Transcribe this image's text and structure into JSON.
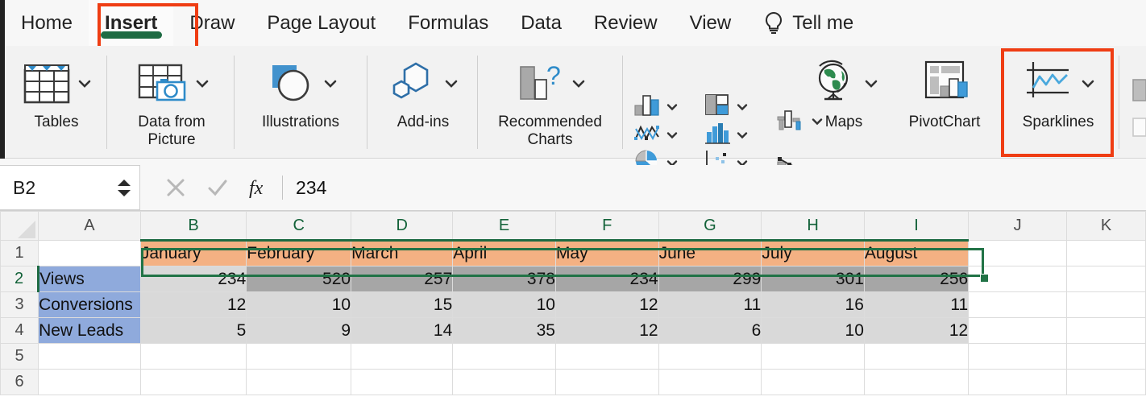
{
  "app": {
    "accent_green": "#217346",
    "annotation_color": "#ef3d13",
    "header_fill": "#f4b183",
    "label_fill": "#8faadc",
    "row_fill": "#d9d9d9",
    "selected_fill": "#a6a6a6"
  },
  "ribbon_tabs": [
    {
      "label": "Home",
      "active": false
    },
    {
      "label": "Insert",
      "active": true,
      "annotated": true
    },
    {
      "label": "Draw",
      "active": false
    },
    {
      "label": "Page Layout",
      "active": false
    },
    {
      "label": "Formulas",
      "active": false
    },
    {
      "label": "Data",
      "active": false
    },
    {
      "label": "Review",
      "active": false
    },
    {
      "label": "View",
      "active": false
    },
    {
      "label": "Tell me",
      "active": false,
      "icon": "lightbulb-icon"
    }
  ],
  "ribbon_groups": [
    {
      "label": "Tables",
      "icon": "tables-icon",
      "dropdown": true
    },
    {
      "label": "Data from\nPicture",
      "icon": "data-from-picture-icon",
      "dropdown": true
    },
    {
      "label": "Illustrations",
      "icon": "illustrations-icon",
      "dropdown": true
    },
    {
      "label": "Add-ins",
      "icon": "add-ins-icon",
      "dropdown": true
    },
    {
      "label": "Recommended\nCharts",
      "icon": "recommended-charts-icon",
      "dropdown": true
    },
    {
      "label": "Maps",
      "icon": "maps-globe-icon",
      "dropdown": true
    },
    {
      "label": "PivotChart",
      "icon": "pivotchart-icon",
      "dropdown": false
    },
    {
      "label": "Sparklines",
      "icon": "sparklines-icon",
      "dropdown": true,
      "annotated": true
    }
  ],
  "chart_icon_matrix": [
    [
      {
        "icon": "column-chart-icon"
      },
      {
        "icon": "line-chart-icon"
      },
      {
        "icon": "pie-chart-icon"
      }
    ],
    [
      {
        "icon": "hierarchy-chart-icon"
      },
      {
        "icon": "statistic-chart-icon"
      },
      {
        "icon": "scatter-chart-icon"
      }
    ],
    [
      {
        "icon": "waterfall-chart-icon"
      },
      {
        "icon": "combo-chart-icon"
      }
    ]
  ],
  "formula_bar": {
    "name_box_value": "B2",
    "name_box_spinner": "spinner-icon",
    "cancel_icon": "cancel-x-icon",
    "confirm_icon": "confirm-check-icon",
    "function_icon": "fx-icon",
    "formula_value": "234"
  },
  "sheet": {
    "column_headers": [
      "A",
      "B",
      "C",
      "D",
      "E",
      "F",
      "G",
      "H",
      "I",
      "J",
      "K"
    ],
    "selected_columns": [
      "B",
      "C",
      "D",
      "E",
      "F",
      "G",
      "H",
      "I"
    ],
    "row_headers": [
      "1",
      "2",
      "3",
      "4",
      "5",
      "6"
    ],
    "selected_rows": [
      "2"
    ],
    "active_cell": "B2",
    "selected_range": "B2:I2",
    "rows": [
      {
        "row": "1",
        "cells": [
          {
            "col": "A",
            "value": "",
            "style": "white",
            "align": "left"
          },
          {
            "col": "B",
            "value": "January",
            "style": "orange",
            "align": "left"
          },
          {
            "col": "C",
            "value": "February",
            "style": "orange",
            "align": "left"
          },
          {
            "col": "D",
            "value": "March",
            "style": "orange",
            "align": "left"
          },
          {
            "col": "E",
            "value": "April",
            "style": "orange",
            "align": "left"
          },
          {
            "col": "F",
            "value": "May",
            "style": "orange",
            "align": "left"
          },
          {
            "col": "G",
            "value": "June",
            "style": "orange",
            "align": "left"
          },
          {
            "col": "H",
            "value": "July",
            "style": "orange",
            "align": "left"
          },
          {
            "col": "I",
            "value": "August",
            "style": "orange",
            "align": "left"
          },
          {
            "col": "J",
            "value": "",
            "style": "white",
            "align": "left"
          },
          {
            "col": "K",
            "value": "",
            "style": "white",
            "align": "left"
          }
        ]
      },
      {
        "row": "2",
        "cells": [
          {
            "col": "A",
            "value": "Views",
            "style": "blue",
            "align": "left"
          },
          {
            "col": "B",
            "value": "234",
            "style": "lgray",
            "align": "right"
          },
          {
            "col": "C",
            "value": "520",
            "style": "mgray",
            "align": "right"
          },
          {
            "col": "D",
            "value": "257",
            "style": "mgray",
            "align": "right"
          },
          {
            "col": "E",
            "value": "378",
            "style": "mgray",
            "align": "right"
          },
          {
            "col": "F",
            "value": "234",
            "style": "mgray",
            "align": "right"
          },
          {
            "col": "G",
            "value": "299",
            "style": "mgray",
            "align": "right"
          },
          {
            "col": "H",
            "value": "301",
            "style": "mgray",
            "align": "right"
          },
          {
            "col": "I",
            "value": "256",
            "style": "mgray",
            "align": "right"
          },
          {
            "col": "J",
            "value": "",
            "style": "white",
            "align": "left"
          },
          {
            "col": "K",
            "value": "",
            "style": "white",
            "align": "left"
          }
        ]
      },
      {
        "row": "3",
        "cells": [
          {
            "col": "A",
            "value": "Conversions",
            "style": "blue",
            "align": "left"
          },
          {
            "col": "B",
            "value": "12",
            "style": "lgray",
            "align": "right"
          },
          {
            "col": "C",
            "value": "10",
            "style": "lgray",
            "align": "right"
          },
          {
            "col": "D",
            "value": "15",
            "style": "lgray",
            "align": "right"
          },
          {
            "col": "E",
            "value": "10",
            "style": "lgray",
            "align": "right"
          },
          {
            "col": "F",
            "value": "12",
            "style": "lgray",
            "align": "right"
          },
          {
            "col": "G",
            "value": "11",
            "style": "lgray",
            "align": "right"
          },
          {
            "col": "H",
            "value": "16",
            "style": "lgray",
            "align": "right"
          },
          {
            "col": "I",
            "value": "11",
            "style": "lgray",
            "align": "right"
          },
          {
            "col": "J",
            "value": "",
            "style": "white",
            "align": "left"
          },
          {
            "col": "K",
            "value": "",
            "style": "white",
            "align": "left"
          }
        ]
      },
      {
        "row": "4",
        "cells": [
          {
            "col": "A",
            "value": "New Leads",
            "style": "blue",
            "align": "left"
          },
          {
            "col": "B",
            "value": "5",
            "style": "lgray",
            "align": "right"
          },
          {
            "col": "C",
            "value": "9",
            "style": "lgray",
            "align": "right"
          },
          {
            "col": "D",
            "value": "14",
            "style": "lgray",
            "align": "right"
          },
          {
            "col": "E",
            "value": "35",
            "style": "lgray",
            "align": "right"
          },
          {
            "col": "F",
            "value": "12",
            "style": "lgray",
            "align": "right"
          },
          {
            "col": "G",
            "value": "6",
            "style": "lgray",
            "align": "right"
          },
          {
            "col": "H",
            "value": "10",
            "style": "lgray",
            "align": "right"
          },
          {
            "col": "I",
            "value": "12",
            "style": "lgray",
            "align": "right"
          },
          {
            "col": "J",
            "value": "",
            "style": "white",
            "align": "left"
          },
          {
            "col": "K",
            "value": "",
            "style": "white",
            "align": "left"
          }
        ]
      },
      {
        "row": "5",
        "cells": [
          {
            "col": "A",
            "value": "",
            "style": "white",
            "align": "left"
          },
          {
            "col": "B",
            "value": "",
            "style": "white",
            "align": "left"
          },
          {
            "col": "C",
            "value": "",
            "style": "white",
            "align": "left"
          },
          {
            "col": "D",
            "value": "",
            "style": "white",
            "align": "left"
          },
          {
            "col": "E",
            "value": "",
            "style": "white",
            "align": "left"
          },
          {
            "col": "F",
            "value": "",
            "style": "white",
            "align": "left"
          },
          {
            "col": "G",
            "value": "",
            "style": "white",
            "align": "left"
          },
          {
            "col": "H",
            "value": "",
            "style": "white",
            "align": "left"
          },
          {
            "col": "I",
            "value": "",
            "style": "white",
            "align": "left"
          },
          {
            "col": "J",
            "value": "",
            "style": "white",
            "align": "left"
          },
          {
            "col": "K",
            "value": "",
            "style": "white",
            "align": "left"
          }
        ]
      },
      {
        "row": "6",
        "cells": [
          {
            "col": "A",
            "value": "",
            "style": "white",
            "align": "left"
          },
          {
            "col": "B",
            "value": "",
            "style": "white",
            "align": "left"
          },
          {
            "col": "C",
            "value": "",
            "style": "white",
            "align": "left"
          },
          {
            "col": "D",
            "value": "",
            "style": "white",
            "align": "left"
          },
          {
            "col": "E",
            "value": "",
            "style": "white",
            "align": "left"
          },
          {
            "col": "F",
            "value": "",
            "style": "white",
            "align": "left"
          },
          {
            "col": "G",
            "value": "",
            "style": "white",
            "align": "left"
          },
          {
            "col": "H",
            "value": "",
            "style": "white",
            "align": "left"
          },
          {
            "col": "I",
            "value": "",
            "style": "white",
            "align": "left"
          },
          {
            "col": "J",
            "value": "",
            "style": "white",
            "align": "left"
          },
          {
            "col": "K",
            "value": "",
            "style": "white",
            "align": "left"
          }
        ]
      }
    ]
  }
}
